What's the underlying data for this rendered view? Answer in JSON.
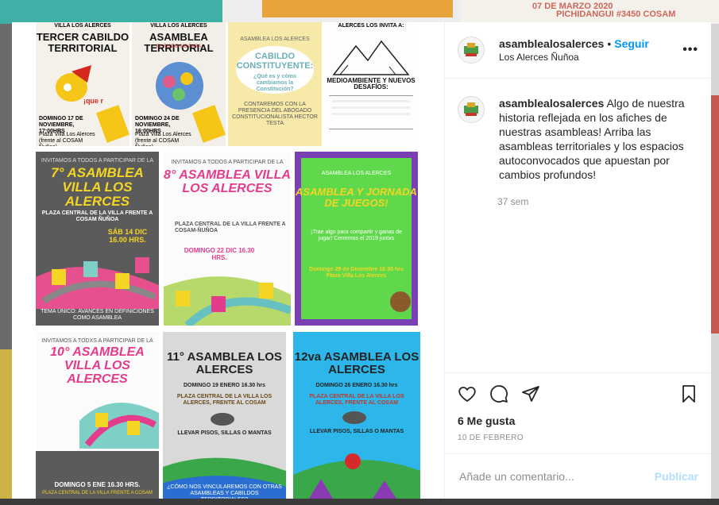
{
  "post": {
    "username": "asamblealosalerces",
    "location": "Los Alerces Ñuñoa",
    "follow_label": "Seguir",
    "separator": "•",
    "more_label": "•••",
    "caption": "Algo de nuestra historia reflejada en los afiches de nuestras asambleas! Arriba las asambleas territoriales y los espacios autoconvocados que apuestan por cambios profundos!",
    "time_ago": "37 sem",
    "likes": "6 Me gusta",
    "date": "10 DE FEBRERO",
    "comment_placeholder": "Añade un comentario...",
    "publish_label": "Publicar"
  },
  "background": {
    "banner_line1": "07 DE MARZO 2020",
    "banner_line2": "PICHIDANGUI #3450 COSAM"
  },
  "posters": {
    "p1": {
      "top": "VILLA LOS ALERCES",
      "title": "TERCER CABILDO TERRITORIAL",
      "date": "DOMINGO 17 DE NOVIEMBRE, 17:00HRS",
      "place": "Plaza Villa Los Alerces (frente al COSAM Ñuñoa)"
    },
    "p2": {
      "top": "VILLA LOS ALERCES",
      "title": "ASAMBLEA TERRITORIAL",
      "art": "EL RUIDO NO PARA",
      "date": "DOMINGO 24 DE NOVIEMBRE, 16:00HRS",
      "place": "Plaza Villa Los Alerces (frente al COSAM Ñuñoa)"
    },
    "p3": {
      "top": "ASAMBLEA LOS ALERCES",
      "title": "CABILDO CONSTITUYENTE:",
      "q": "¿Qué es y cómo cambiamos la Constitución?",
      "body": "CONTAREMOS CON LA PRESENCIA DEL ABOGADO CONSTITUCIONALISTA HECTOR TESTA"
    },
    "p4": {
      "top": "ALERCES LOS INVITA A:",
      "title": "MEDIOAMBIENTE Y NUEVOS DESAFÍOS:"
    },
    "p5": {
      "top": "INVITAMOS A TODOS A PARTICIPAR DE LA",
      "title": "7° ASAMBLEA VILLA LOS ALERCES",
      "place": "PLAZA CENTRAL DE LA VILLA FRENTE A COSAM ÑUÑOA",
      "date": "SÁB 14 DIC 16.00 HRS.",
      "topic": "TEMA ÚNICO: AVANCES EN DEFINICIONES COMO ASAMBLEA"
    },
    "p6": {
      "top": "INVITAMOS A TODOS A PARTICIPAR DE LA",
      "title": "8° ASAMBLEA VILLA LOS ALERCES",
      "place": "PLAZA CENTRAL DE LA VILLA FRENTE A COSAM-ÑUÑOA",
      "date": "DOMINGO 22 DIC 16.30 HRS."
    },
    "p7": {
      "top": "ASAMBLEA LOS ALERCES",
      "title": "ASAMBLEA Y JORNADA DE JUEGOS!",
      "body": "¡Trae algo para compartir y ganas de jugar! Cerremos el 2019 juntxs",
      "date": "Domingo 29 de Diciembre 16:30 hrs Plaza Villa Los Alerces"
    },
    "p8": {
      "top": "INVITAMOS A TODXS A PARTICIPAR DE LA",
      "title": "10° ASAMBLEA VILLA LOS ALERCES",
      "date": "DOMINGO 5 ENE 16.30 HRS.",
      "place": "PLAZA CENTRAL DE LA VILLA FRENTE A COSAM"
    },
    "p9": {
      "title": "11° ASAMBLEA LOS ALERCES",
      "date": "DOMINGO 19 ENERO 16.30 hrs",
      "place": "PLAZA CENTRAL DE LA VILLA LOS ALERCES, FRENTE AL COSAM",
      "bring": "LLEVAR PISOS, SILLAS O MANTAS",
      "q": "¿CÓMO NOS VINCULAREMOS CON OTRAS ASAMBLEAS Y CABILDOS TERRITORIALES?"
    },
    "p10": {
      "title": "12va ASAMBLEA LOS ALERCES",
      "date": "DOMINGO 26 ENERO 16.30 hrs",
      "place": "PLAZA CENTRAL DE LA VILLA LOS ALERCES, FRENTE AL COSAM",
      "bring": "LLEVAR PISOS, SILLAS O MANTAS"
    }
  },
  "colors": {
    "link_blue": "#0095f6",
    "publish_disabled": "#b2dffc",
    "text": "#262626",
    "muted": "#8e8e8e"
  }
}
